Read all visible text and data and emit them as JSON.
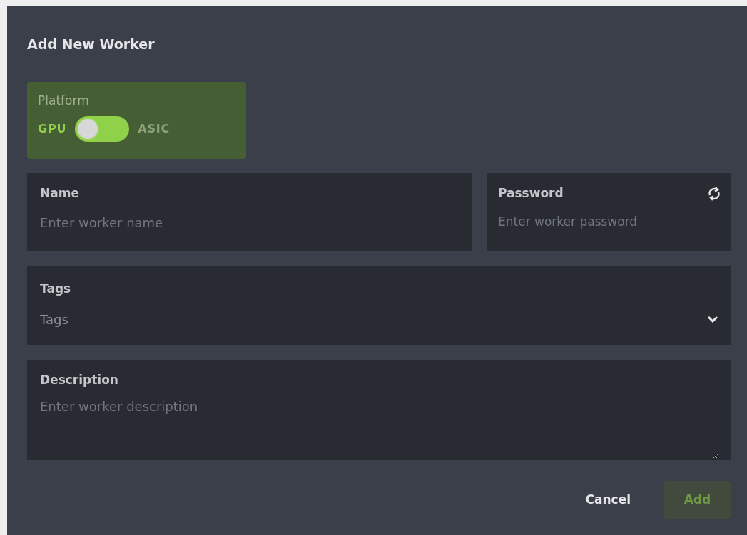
{
  "dialog": {
    "title": "Add New Worker",
    "platform": {
      "label": "Platform",
      "options": [
        {
          "label": "GPU",
          "selected": true
        },
        {
          "label": "ASIC",
          "selected": false
        }
      ]
    },
    "name": {
      "label": "Name",
      "placeholder": "Enter worker name"
    },
    "password": {
      "label": "Password",
      "placeholder": "Enter worker password"
    },
    "tags": {
      "label": "Tags",
      "placeholder": "Tags"
    },
    "description": {
      "label": "Description",
      "placeholder": "Enter worker description"
    },
    "buttons": [
      {
        "label": "Cancel",
        "kind": "text",
        "disabled": false
      },
      {
        "label": "Add",
        "kind": "primary",
        "disabled": true
      }
    ]
  }
}
